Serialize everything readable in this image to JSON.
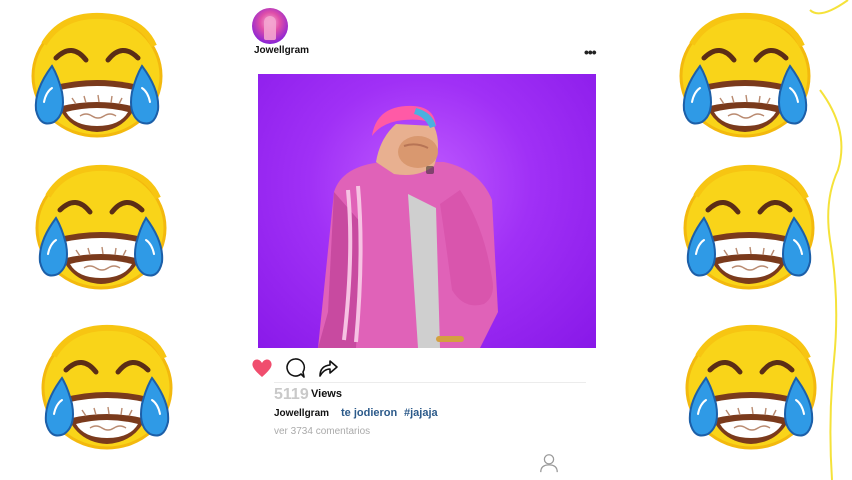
{
  "post": {
    "username": "Jowellgram",
    "views_count": "5119",
    "views_label": "Views",
    "caption_username": "Jowellgram",
    "caption_text": "te jodieron",
    "caption_hashtag": "#jajaja",
    "comments_link": "ver 3734 comentarios"
  },
  "colors": {
    "photo_background": "#a030f6",
    "like_heart": "#f04e6e",
    "caption_link": "#2c5a8a",
    "emoji_face": "#f9d419",
    "emoji_tears": "#2f9ae6"
  },
  "icons": {
    "like": "heart-icon",
    "comment": "comment-icon",
    "share": "share-arrow-icon",
    "more": "more-dots-icon",
    "profile": "profile-icon"
  },
  "decorations": {
    "emoji": "face-with-tears-of-joy",
    "emoji_count": 6
  }
}
